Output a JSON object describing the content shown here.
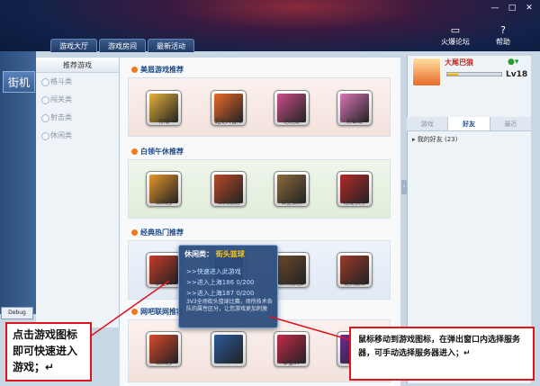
{
  "window": {
    "minimize": "—",
    "maximize": "□",
    "close": "✕"
  },
  "header": {
    "forum_label": "火爆论坛",
    "help_label": "帮助",
    "tabs": [
      {
        "label": "游戏大厅",
        "active": true
      },
      {
        "label": "游戏房间",
        "active": false
      },
      {
        "label": "最新活动",
        "active": false
      }
    ]
  },
  "leftnav": {
    "arcade_label": "街机",
    "debug_label": "Debug"
  },
  "categories": {
    "header": "推荐游戏",
    "items": [
      "格斗类",
      "闯关类",
      "射击类",
      "休闲类"
    ]
  },
  "sections": [
    {
      "title": "美眉游戏推荐",
      "games": [
        {
          "name": "侍魂",
          "color": "#e5b23a"
        },
        {
          "name": "超能大冒险",
          "color": "#e96a2a"
        },
        {
          "name": "泡泡龙",
          "color": "#c9508a"
        },
        {
          "name": "彩虹岛",
          "color": "#d975b8"
        }
      ]
    },
    {
      "title": "白领午休推荐",
      "games": [
        {
          "name": "三国志",
          "color": "#e4962a"
        },
        {
          "name": "三国战纪",
          "color": "#b94a2a"
        },
        {
          "name": "合金弹头",
          "color": "#8a6a3a"
        },
        {
          "name": "恐龙快打",
          "color": "#b42a2a"
        }
      ]
    },
    {
      "title": "经典热门推荐",
      "games": [
        {
          "name": "拳皇97",
          "color": "#c83a2a"
        },
        {
          "name": "",
          "color": "#4a6a9a"
        },
        {
          "name": "三国战纪2",
          "color": "#6a4a2a"
        },
        {
          "name": "街头霸王",
          "color": "#9a3a2a"
        }
      ]
    },
    {
      "title": "网吧联网推荐",
      "games": [
        {
          "name": "三国志",
          "color": "#d84a2a"
        },
        {
          "name": "",
          "color": "#2a5a9a"
        },
        {
          "name": "拳皇97",
          "color": "#c42a4a"
        },
        {
          "name": "街霸2",
          "color": "#6a2a9a"
        }
      ]
    }
  ],
  "user": {
    "name": "大尾巴狼",
    "level": "Lv18",
    "status_icon": "●▾",
    "exp_fraction": 0.2
  },
  "friend_tabs": [
    "游戏",
    "好友",
    "最近"
  ],
  "friend_tab_active": 1,
  "friends_label": "我的好友 (23)",
  "popup": {
    "category": "休闲类",
    "game": "街头篮球",
    "links": [
      ">>快速进入此游戏",
      ">>进入上海186  0/200",
      ">>进入上海187  0/200"
    ],
    "desc": "3V3全场街头篮球比赛，场所技术各队的属性区分，让您游戏更加刺激"
  },
  "annotations": {
    "left": "点击游戏图标即可快速进入游戏；↵",
    "right": "鼠标移动到游戏图标，在弹出窗口内选择服务器，可手动选择服务器进入；↵"
  }
}
